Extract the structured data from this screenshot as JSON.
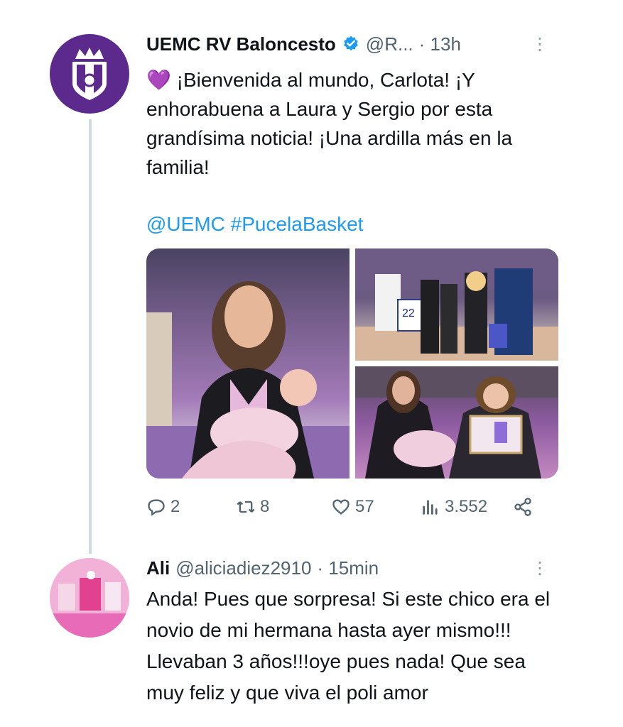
{
  "tweet1": {
    "display_name": "UEMC RV Baloncesto",
    "handle": "@R...",
    "time": "· 13h",
    "text": "💜 ¡Bienvenida al mundo, Carlota! ¡Y enhorabuena a Laura y Sergio por esta grandísima noticia! ¡Una ardilla más en la familia!",
    "tags": "@UEMC #PucelaBasket",
    "avatar_icon": "club-crest-icon",
    "more_icon": "more-options-icon"
  },
  "media": {
    "photos": [
      "photo-1",
      "photo-2",
      "photo-3"
    ],
    "jersey_number": "22"
  },
  "actions": {
    "reply_count": "2",
    "retweet_count": "8",
    "like_count": "57",
    "views_count": "3.552"
  },
  "tweet2": {
    "display_name": "Ali",
    "handle": "@aliciadiez2910",
    "time": "· 15min",
    "text": "Anda! Pues que sorpresa! Si este chico era el novio de mi hermana hasta ayer mismo!!! Llevaban 3 años!!!oye pues nada! Que sea muy feliz y que viva el poli amor"
  }
}
